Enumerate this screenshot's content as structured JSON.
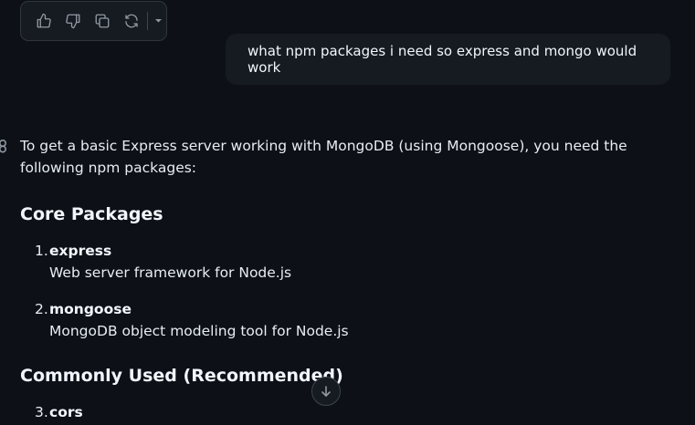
{
  "toolbar": {
    "icons": [
      "thumbs-up-icon",
      "thumbs-down-icon",
      "copy-icon",
      "refresh-icon",
      "chevron-down-icon"
    ]
  },
  "user_message": {
    "text": "what npm packages i need so express and mongo would work"
  },
  "response": {
    "intro": "To get a basic Express server working with MongoDB (using Mongoose), you need the following npm packages:",
    "sections": [
      {
        "heading": "Core Packages",
        "items": [
          {
            "number": "1.",
            "name": "express",
            "description": "Web server framework for Node.js"
          },
          {
            "number": "2.",
            "name": "mongoose",
            "description": "MongoDB object modeling tool for Node.js"
          }
        ]
      },
      {
        "heading": "Commonly Used (Recommended)",
        "items": [
          {
            "number": "3.",
            "name": "cors",
            "description": ""
          }
        ]
      }
    ]
  },
  "colors": {
    "background": "#0d1117",
    "surface": "#161b22",
    "border": "#30363d",
    "text": "#e6edf3",
    "icon": "#9198a1"
  }
}
